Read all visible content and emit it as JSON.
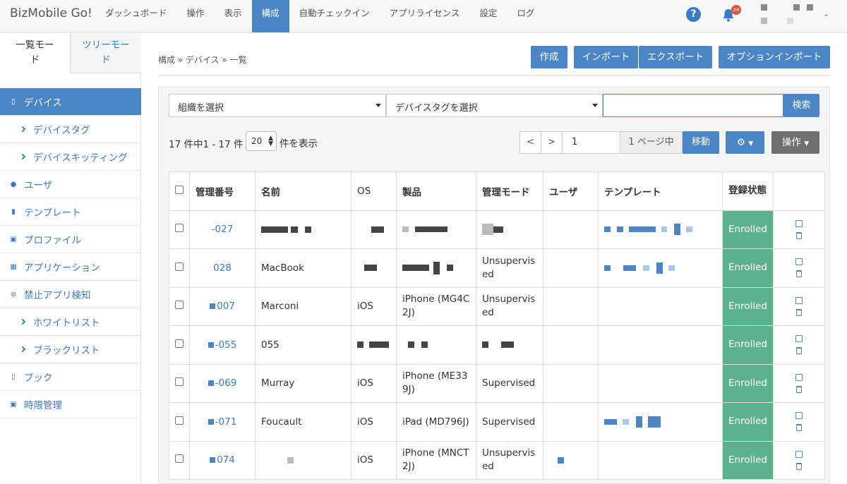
{
  "app": {
    "title": "BizMobile Go!"
  },
  "nav": {
    "items": [
      "ダッシュボード",
      "操作",
      "表示",
      "構成",
      "自動チェックイン",
      "アプリライセンス",
      "設定",
      "ログ"
    ],
    "active_index": 3
  },
  "header": {
    "notification_count": "24",
    "help_symbol": "?"
  },
  "sidebar": {
    "modes": [
      "一覧モード",
      "ツリーモード"
    ],
    "items": [
      {
        "label": "デバイス",
        "icon": "mobile-icon",
        "active": true
      },
      {
        "label": "デバイスタグ",
        "icon": "chevron-right-icon"
      },
      {
        "label": "デバイスキッティング",
        "icon": "chevron-right-icon"
      },
      {
        "label": "ユーザ",
        "icon": "user-icon"
      },
      {
        "label": "テンプレート",
        "icon": "file-icon"
      },
      {
        "label": "プロファイル",
        "icon": "inbox-icon"
      },
      {
        "label": "アプリケーション",
        "icon": "grid-icon"
      },
      {
        "label": "禁止アプリ検知",
        "icon": "ban-icon"
      },
      {
        "label": "ホワイトリスト",
        "icon": "chevron-right-icon"
      },
      {
        "label": "ブラックリスト",
        "icon": "chevron-right-icon"
      },
      {
        "label": "ブック",
        "icon": "book-icon"
      },
      {
        "label": "時限管理",
        "icon": "calendar-icon"
      }
    ]
  },
  "breadcrumb": "構成 » デバイス » 一覧",
  "toolbar": {
    "create": "作成",
    "import": "インポート",
    "export": "エクスポート",
    "option_import": "オプションインポート"
  },
  "filters": {
    "org": "組織を選択",
    "tag": "デバイスタグを選択",
    "search_value": "",
    "search_button": "検索"
  },
  "pagination": {
    "count_text": "17 件中1 - 17 件",
    "page_size": "20",
    "per_page": "件を表示",
    "prev": "<",
    "next": ">",
    "current_page": "1",
    "total_text": "1 ページ中",
    "go": "移動",
    "ops": "操作"
  },
  "table": {
    "headers": [
      "",
      "管理番号",
      "名前",
      "OS",
      "製品",
      "管理モード",
      "ユーザ",
      "テンプレート",
      "登録状態",
      ""
    ],
    "rows": [
      {
        "id": "-027",
        "name": "",
        "os": "",
        "product": "",
        "mode": "",
        "user": "",
        "status": "Enrolled"
      },
      {
        "id": "028",
        "name": "MacBook",
        "os": "",
        "product": "",
        "mode": "Unsupervised",
        "user": "",
        "status": "Enrolled"
      },
      {
        "id": "007",
        "name": "Marconi",
        "os": "iOS",
        "product": "iPhone (MG4C2J)",
        "mode": "Unsupervised",
        "user": "",
        "status": "Enrolled"
      },
      {
        "id": "-055",
        "name": "055",
        "os": "",
        "product": "",
        "mode": "",
        "user": "",
        "status": "Enrolled"
      },
      {
        "id": "-069",
        "name": "Murray",
        "os": "iOS",
        "product": "iPhone (ME339J)",
        "mode": "Supervised",
        "user": "",
        "status": "Enrolled"
      },
      {
        "id": "-071",
        "name": "Foucault",
        "os": "iOS",
        "product": "iPad (MD796J)",
        "mode": "Supervised",
        "user": "",
        "status": "Enrolled"
      },
      {
        "id": "074",
        "name": "",
        "os": "iOS",
        "product": "iPhone (MNCT2J)",
        "mode": "Unsupervised",
        "user": "",
        "status": "Enrolled"
      }
    ]
  }
}
